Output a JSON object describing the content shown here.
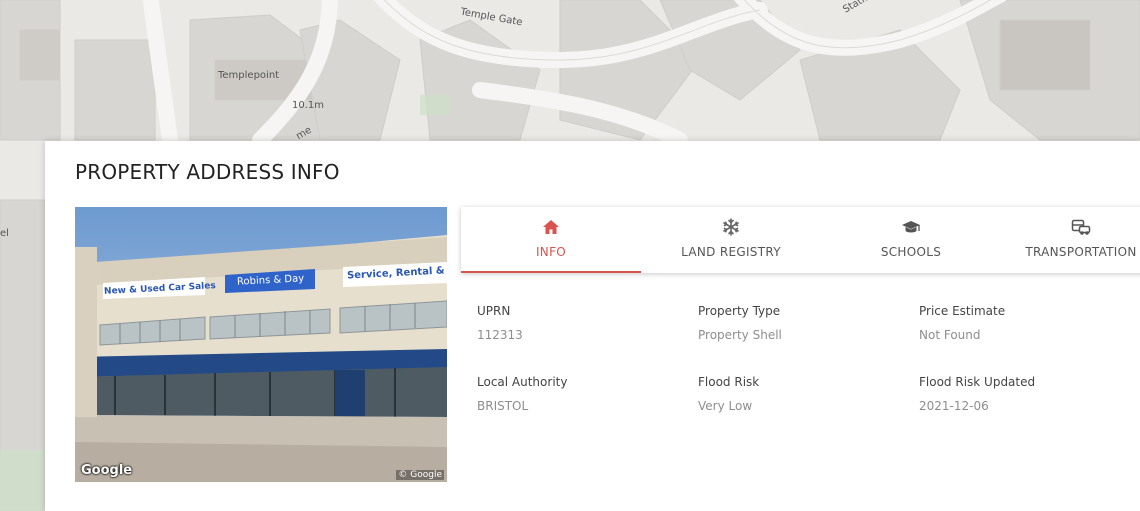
{
  "map": {
    "labels": {
      "temple_gate": "Temple Gate",
      "templepoint": "Templepoint",
      "height": "10.1m",
      "station": "Statio",
      "partial_left": "el",
      "partial_road": "me"
    }
  },
  "modal": {
    "title": "PROPERTY ADDRESS INFO",
    "photo": {
      "google_logo": "Google",
      "copyright": "© Google",
      "signs": {
        "sign1": "New & Used Car Sales",
        "sign2": "Robins & Day",
        "sign3": "Service, Rental &"
      }
    },
    "tabs": [
      {
        "label": "INFO",
        "icon": "home-icon",
        "active": true
      },
      {
        "label": "LAND REGISTRY",
        "icon": "snowflake-icon",
        "active": false
      },
      {
        "label": "SCHOOLS",
        "icon": "graduation-cap-icon",
        "active": false
      },
      {
        "label": "TRANSPORTATION",
        "icon": "bus-car-icon",
        "active": false
      }
    ],
    "fields": {
      "uprn": {
        "label": "UPRN",
        "value": "112313"
      },
      "property_type": {
        "label": "Property Type",
        "value": "Property Shell"
      },
      "price_estimate": {
        "label": "Price Estimate",
        "value": "Not Found"
      },
      "local_authority": {
        "label": "Local Authority",
        "value": "BRISTOL"
      },
      "flood_risk": {
        "label": "Flood Risk",
        "value": "Very Low"
      },
      "flood_risk_updated": {
        "label": "Flood Risk Updated",
        "value": "2021-12-06"
      }
    }
  },
  "colors": {
    "accent": "#d9534f",
    "map_bg": "#e9e7e4"
  }
}
